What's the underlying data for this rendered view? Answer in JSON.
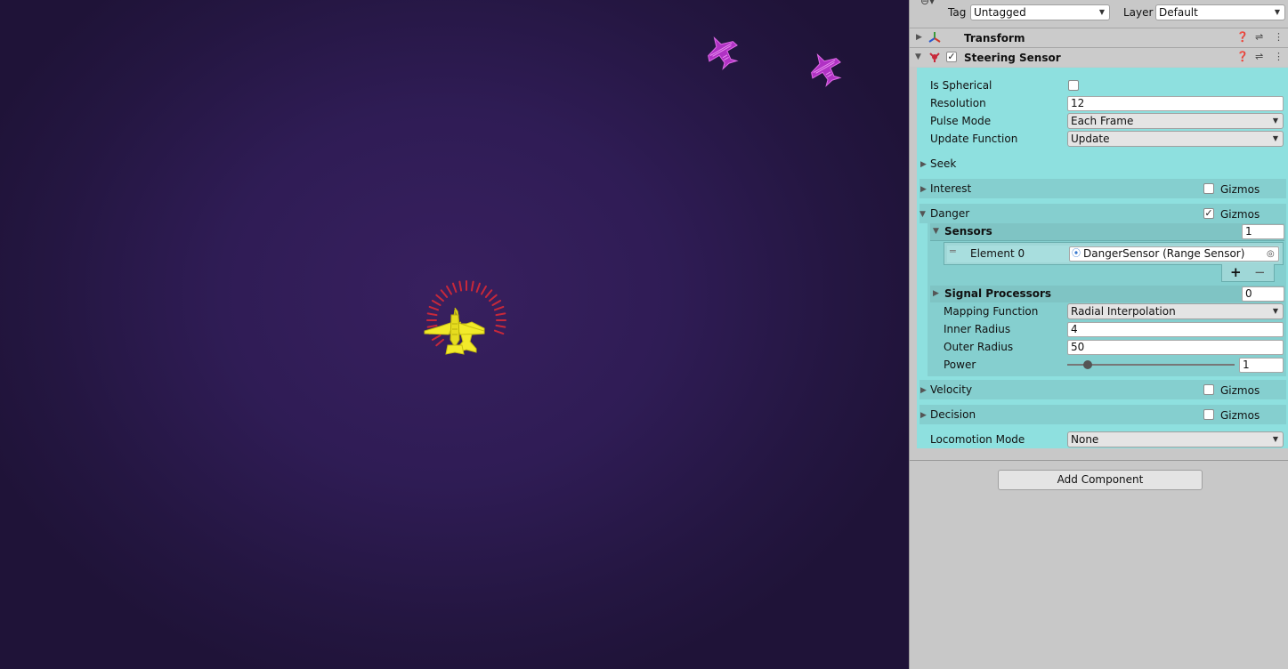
{
  "header": {
    "tag_label": "Tag",
    "tag_value": "Untagged",
    "layer_label": "Layer",
    "layer_value": "Default"
  },
  "components": {
    "transform": {
      "title": "Transform"
    },
    "steering": {
      "title": "Steering Sensor",
      "enabled": true,
      "is_spherical": {
        "label": "Is Spherical",
        "checked": false
      },
      "resolution": {
        "label": "Resolution",
        "value": "12"
      },
      "pulse_mode": {
        "label": "Pulse Mode",
        "value": "Each Frame"
      },
      "update_function": {
        "label": "Update Function",
        "value": "Update"
      },
      "seek": {
        "label": "Seek"
      },
      "interest": {
        "label": "Interest",
        "gizmos_label": "Gizmos",
        "gizmos": false
      },
      "danger": {
        "label": "Danger",
        "gizmos_label": "Gizmos",
        "gizmos": true,
        "sensors": {
          "label": "Sensors",
          "count": "1",
          "elements": [
            {
              "label": "Element 0",
              "value": "DangerSensor (Range Sensor)"
            }
          ],
          "add_label": "+",
          "remove_label": "−"
        },
        "signal_processors": {
          "label": "Signal Processors",
          "count": "0"
        },
        "mapping_function": {
          "label": "Mapping Function",
          "value": "Radial Interpolation"
        },
        "inner_radius": {
          "label": "Inner Radius",
          "value": "4"
        },
        "outer_radius": {
          "label": "Outer Radius",
          "value": "50"
        },
        "power": {
          "label": "Power",
          "value": "1",
          "slider_fraction": 0.12
        }
      },
      "velocity": {
        "label": "Velocity",
        "gizmos_label": "Gizmos",
        "gizmos": false
      },
      "decision": {
        "label": "Decision",
        "gizmos_label": "Gizmos",
        "gizmos": false
      },
      "locomotion_mode": {
        "label": "Locomotion Mode",
        "value": "None"
      }
    }
  },
  "add_component_label": "Add Component",
  "colors": {
    "game_bg": "#2f1c55",
    "player": "#f2ea2a",
    "enemy": "#c43ccf",
    "danger_ring": "#c8283a",
    "component_bg": "#8ee0df"
  }
}
